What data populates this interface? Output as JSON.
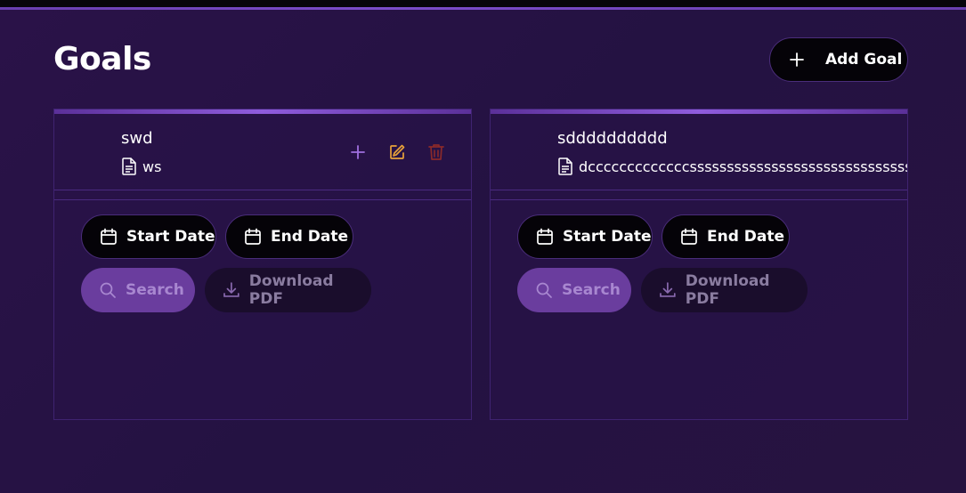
{
  "page": {
    "title": "Goals"
  },
  "add_button": {
    "label": "Add Goal",
    "icon": "plus-icon"
  },
  "colors": {
    "accent": "#8f5cdd",
    "edit": "#e8a23a",
    "delete": "#8a2a2a",
    "add_action": "#a070e0"
  },
  "goals": [
    {
      "name": "swd",
      "description": "ws",
      "show_actions": true,
      "start_date_label": "Start Date",
      "end_date_label": "End Date",
      "search_label": "Search",
      "download_label": "Download PDF"
    },
    {
      "name": "sdddddddddd",
      "description": "dcccccccccccccsssssssssssssssssssssssssssssssssssss",
      "show_actions": false,
      "start_date_label": "Start Date",
      "end_date_label": "End Date",
      "search_label": "Search",
      "download_label": "Download PDF"
    }
  ]
}
